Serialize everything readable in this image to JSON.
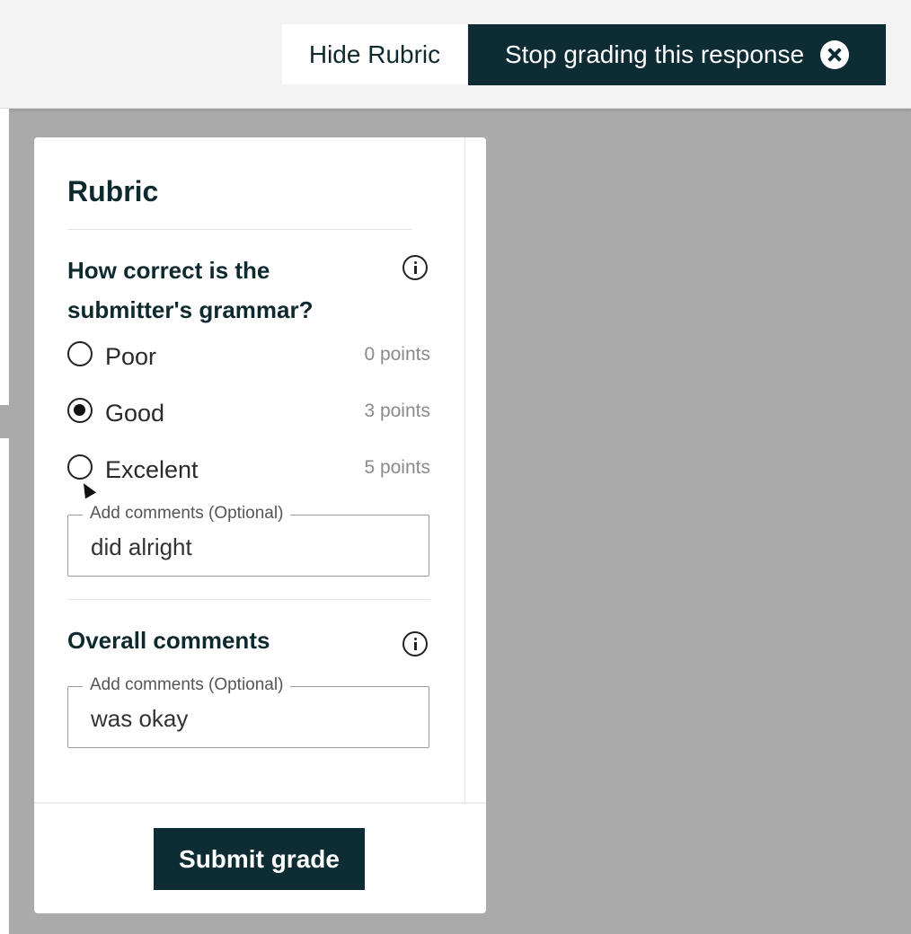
{
  "header": {
    "hide_rubric_label": "Hide Rubric",
    "stop_grading_label": "Stop grading this response"
  },
  "rubric": {
    "title": "Rubric",
    "criterion": {
      "question": "How correct is the submitter's grammar?",
      "options": [
        {
          "label": "Poor",
          "points": "0 points",
          "selected": false
        },
        {
          "label": "Good",
          "points": "3 points",
          "selected": true
        },
        {
          "label": "Excelent",
          "points": "5 points",
          "selected": false
        }
      ],
      "comment": {
        "legend": "Add comments (Optional)",
        "value": "did alright"
      }
    },
    "overall": {
      "label": "Overall comments",
      "comment": {
        "legend": "Add comments (Optional)",
        "value": "was okay"
      }
    },
    "submit_label": "Submit grade"
  },
  "colors": {
    "primary": "#0e2c33",
    "backdrop": "#aaaaaa",
    "header_bg": "#f3f3f3"
  },
  "icons": [
    "close-icon",
    "info-icon",
    "radio-checked",
    "radio-unchecked",
    "mouse-cursor"
  ]
}
